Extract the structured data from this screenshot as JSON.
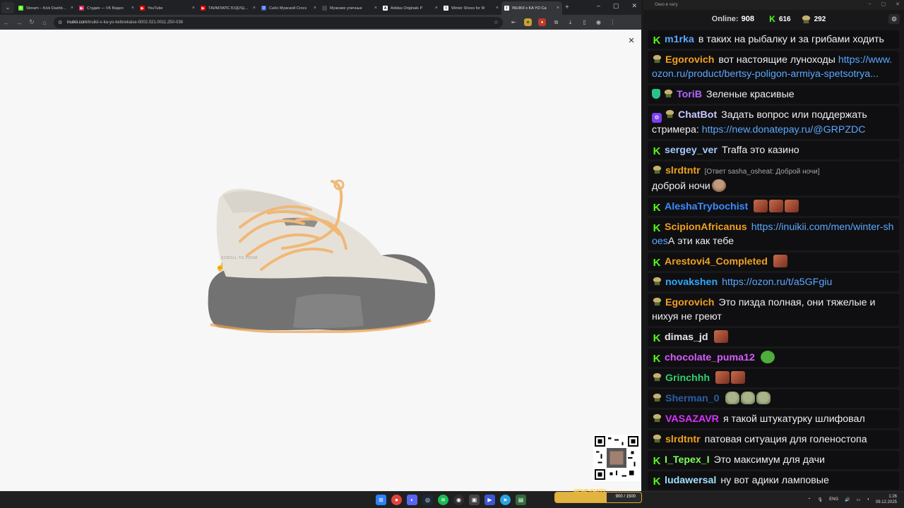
{
  "browser": {
    "tabs": [
      {
        "title": "Stream – Kick Dashboard",
        "favicon_color": "#53fc18",
        "favicon_glyph": "K",
        "active": false
      },
      {
        "title": "Студия — VK Видео",
        "favicon_color": "#e0285c",
        "favicon_glyph": "▶",
        "active": false
      },
      {
        "title": "YouTube",
        "favicon_color": "#ff0000",
        "favicon_glyph": "▶",
        "active": false
      },
      {
        "title": "ТАЙМЛАПС БУДУЩЕГО",
        "favicon_color": "#ff0000",
        "favicon_glyph": "▶",
        "active": false
      },
      {
        "title": "Сабо Мужской Crocs",
        "favicon_color": "#3b5bdb",
        "favicon_glyph": "O",
        "active": false
      },
      {
        "title": "Мужские уличные",
        "favicon_color": "#444444",
        "favicon_glyph": "",
        "active": false
      },
      {
        "title": "Adidas Originals P",
        "favicon_color": "#ffffff",
        "favicon_glyph": "A",
        "active": false
      },
      {
        "title": "Winter Shoes for M",
        "favicon_color": "#ffffff",
        "favicon_glyph": "I",
        "active": false
      },
      {
        "title": "INUIKII x KA YO Ca",
        "favicon_color": "#ffffff",
        "favicon_glyph": "I",
        "active": true
      }
    ],
    "new_tab_label": "+",
    "url_host": "inuikii.com",
    "url_path": "/inuikii-x-ka-yo-kebnekaise-5002.021.0011.250-038",
    "page": {
      "close_icon": "×",
      "scroll_hint": "SCROLL TO ZOOM"
    }
  },
  "chat": {
    "window_title": "Окно в чату",
    "online_label": "Online:",
    "online_count": "908",
    "kick_count": "616",
    "sub_count": "292",
    "messages": [
      {
        "badges": [
          "kick"
        ],
        "user": "m1rka",
        "color": "#5aa8ff",
        "text": "в таких на рыбалку и за грибами ходить"
      },
      {
        "badges": [
          "sub"
        ],
        "user": "Egorovich",
        "color": "#f0a020",
        "text": "вот настоящие луноходы",
        "link": "https://www.ozon.ru/product/bertsy-poligon-armiya-spetsotrya..."
      },
      {
        "badges": [
          "shield",
          "sub"
        ],
        "user": "ToriB",
        "color": "#b366ff",
        "text": "Зеленые красивые"
      },
      {
        "badges": [
          "bot",
          "sub"
        ],
        "user": "ChatBot",
        "color": "#c8c8ff",
        "text": "Задать вопрос или поддержать стримера:",
        "link": "https://new.donatepay.ru/@GRPZDC"
      },
      {
        "badges": [
          "kick"
        ],
        "user": "sergey_ver",
        "color": "#a7c7ff",
        "text": "Traffa это казино"
      },
      {
        "badges": [
          "sub"
        ],
        "user": "slrdtntr",
        "color": "#f0a020",
        "reply": "[Ответ sasha_osheat: Доброй ночи]",
        "text": "доброй ночи",
        "emotes": [
          "face"
        ]
      },
      {
        "badges": [
          "kick"
        ],
        "user": "AleshaTrybochist",
        "color": "#3a8cff",
        "text": "",
        "emotes": [
          "red",
          "red",
          "red"
        ]
      },
      {
        "badges": [
          "kick"
        ],
        "user": "ScipionAfricanus",
        "color": "#f0a020",
        "text": "",
        "link": "https://inuikii.com/men/winter-shoes",
        "text_after": "А эти как тебе"
      },
      {
        "badges": [
          "kick"
        ],
        "user": "Arestovi4_Completed",
        "color": "#f0a020",
        "text": "",
        "emotes": [
          "red"
        ]
      },
      {
        "badges": [
          "sub"
        ],
        "user": "novakshen",
        "color": "#2ea8ff",
        "text": "",
        "link": "https://ozon.ru/t/a5GFgiu"
      },
      {
        "badges": [
          "sub"
        ],
        "user": "Egorovich",
        "color": "#f0a020",
        "text": "Это пизда полная, они тяжелые и нихуя не греют"
      },
      {
        "badges": [
          "kick"
        ],
        "user": "dimas_jd",
        "color": "#e6e6e6",
        "text": "",
        "emotes": [
          "red"
        ]
      },
      {
        "badges": [
          "kick"
        ],
        "user": "chocolate_puma12",
        "color": "#d95bff",
        "text": "",
        "emotes": [
          "pepe"
        ]
      },
      {
        "badges": [
          "sub"
        ],
        "user": "Grinchhh",
        "color": "#30d070",
        "text": "",
        "emotes": [
          "red",
          "red"
        ]
      },
      {
        "badges": [
          "sub"
        ],
        "user": "Sherman_0",
        "color": "#2a5ea8",
        "text": "",
        "emotes": [
          "lizard",
          "lizard",
          "lizard"
        ]
      },
      {
        "badges": [
          "sub"
        ],
        "user": "VASAZAVR",
        "color": "#d933ff",
        "text": "я такой штукатурку шлифовал"
      },
      {
        "badges": [
          "sub"
        ],
        "user": "slrdtntr",
        "color": "#f0a020",
        "text": "патовая ситуация для голеностопа"
      },
      {
        "badges": [
          "kick"
        ],
        "user": "I_Tepex_I",
        "color": "#7cff5a",
        "text": "Это максимум для дачи"
      },
      {
        "badges": [
          "kick"
        ],
        "user": "ludawersal",
        "color": "#a0e0ff",
        "text": "ну вот адики ламповые"
      }
    ]
  },
  "overlay": {
    "meme_party_label": "MEME PARTY",
    "meme_progress": "900 / 1500",
    "meme_progress_fraction": 0.6
  },
  "taskbar": {
    "language": "ENG",
    "time": "1:26",
    "date": "09.12.2025"
  }
}
